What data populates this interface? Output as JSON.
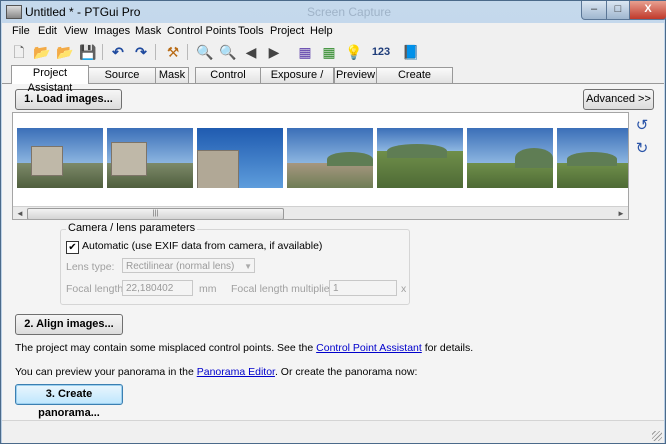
{
  "window": {
    "title": "Untitled * - PTGui Pro",
    "ghost_title": "Screen Capture"
  },
  "caption_buttons": {
    "minimize": "–",
    "maximize": "□",
    "close": "X"
  },
  "menu": [
    "File",
    "Edit",
    "View",
    "Images",
    "Mask",
    "Control Points",
    "Tools",
    "Project",
    "Help"
  ],
  "toolbar": {
    "icons": [
      "new-file-icon",
      "open-folder-icon",
      "open-recent-icon",
      "save-icon",
      "undo-icon",
      "redo-icon",
      "tools-icon",
      "zoom-in-icon",
      "zoom-out-icon",
      "back-icon",
      "forward-icon",
      "image-list-icon",
      "table-icon",
      "bulb-icon",
      "numbers-icon",
      "book-icon"
    ],
    "numbers_label": "123"
  },
  "tabs": [
    "Project Assistant",
    "Source Images",
    "Mask",
    "Control Points",
    "Exposure / HDR",
    "Preview",
    "Create Panorama"
  ],
  "active_tab": "Project Assistant",
  "buttons": {
    "load_images": "1. Load images...",
    "advanced": "Advanced >>",
    "align_images": "2. Align images...",
    "create_panorama": "3. Create panorama..."
  },
  "thumbnails_count": 7,
  "scrollbar": {
    "left_arrow": "◄",
    "right_arrow": "►",
    "grip": "|||"
  },
  "camera_lens": {
    "legend": "Camera / lens parameters",
    "automatic_checked": true,
    "automatic_label": "Automatic (use EXIF data from camera, if available)",
    "lens_type_label": "Lens type:",
    "lens_type_value": "Rectilinear (normal lens)",
    "focal_length_label": "Focal length:",
    "focal_length_value": "22,180402",
    "focal_length_unit": "mm",
    "multiplier_label": "Focal length multiplier:",
    "multiplier_value": "1",
    "multiplier_unit": "x"
  },
  "messages": {
    "cp_prefix": "The project may contain some misplaced control points. See the ",
    "cp_link": "Control Point Assistant",
    "cp_suffix": " for details.",
    "preview_prefix": "You can preview your panorama in the ",
    "preview_link": "Panorama Editor",
    "preview_suffix": ". Or create the panorama now:"
  },
  "colors": {
    "accent": "#3c7fb1",
    "link": "#0000cc",
    "close_button": "#c0392b"
  }
}
